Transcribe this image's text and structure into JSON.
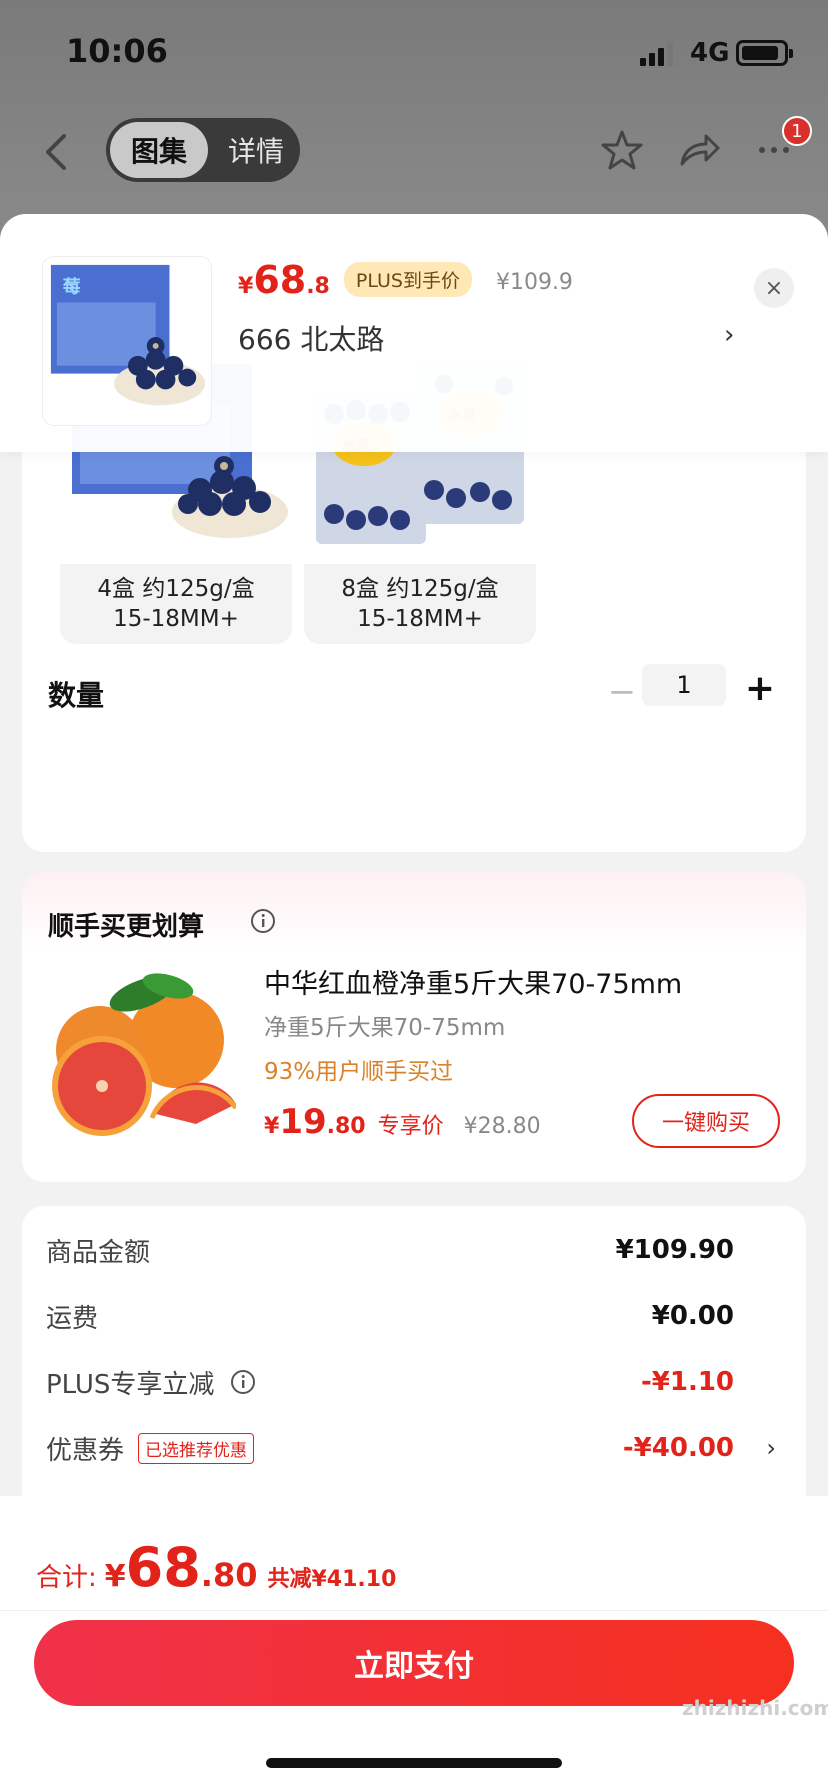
{
  "status": {
    "time": "10:06",
    "network": "4G"
  },
  "nav": {
    "tab_gallery": "图集",
    "tab_detail": "详情",
    "cart_badge": "1"
  },
  "header": {
    "currency": "¥",
    "price_int": "68",
    "price_dec": ".8",
    "plus_tag": "PLUS到手价",
    "original_price": "¥109.9",
    "address": "666  北太路",
    "address_arrow": "›",
    "close": "×"
  },
  "variants": [
    {
      "line1": "4盒 约125g/盒",
      "line2": "15-18MM+"
    },
    {
      "line1": "8盒 约125g/盒",
      "line2": "15-18MM+"
    }
  ],
  "quantity": {
    "label": "数量",
    "minus": "−",
    "value": "1",
    "plus": "+"
  },
  "bundle": {
    "title": "顺手买更划算",
    "name": "中华红血橙净重5斤大果70-75mm",
    "subtitle": "净重5斤大果70-75mm",
    "bought_pct": "93%用户顺手买过",
    "currency": "¥",
    "price_int": "19",
    "price_dec": ".80",
    "price_tag": "专享价",
    "original_price": "¥28.80",
    "buy_button": "一键购买"
  },
  "summary": {
    "goods_label": "商品金额",
    "goods_value": "¥109.90",
    "shipping_label": "运费",
    "shipping_value": "¥0.00",
    "plus_label": "PLUS专享立减",
    "plus_value": "-¥1.10",
    "coupon_label": "优惠券",
    "coupon_tag": "已选推荐优惠",
    "coupon_value": "-¥40.00",
    "coupon_arrow": "›"
  },
  "footer": {
    "total_label": "合计:",
    "currency": "¥",
    "total_int": "68",
    "total_dec": ".80",
    "savings": "共减¥41.10",
    "pay_button": "立即支付",
    "watermark": "zhizhizhi.com"
  },
  "colors": {
    "accent": "#e2231a",
    "plus_tag_bg": "#ffe7b6"
  }
}
